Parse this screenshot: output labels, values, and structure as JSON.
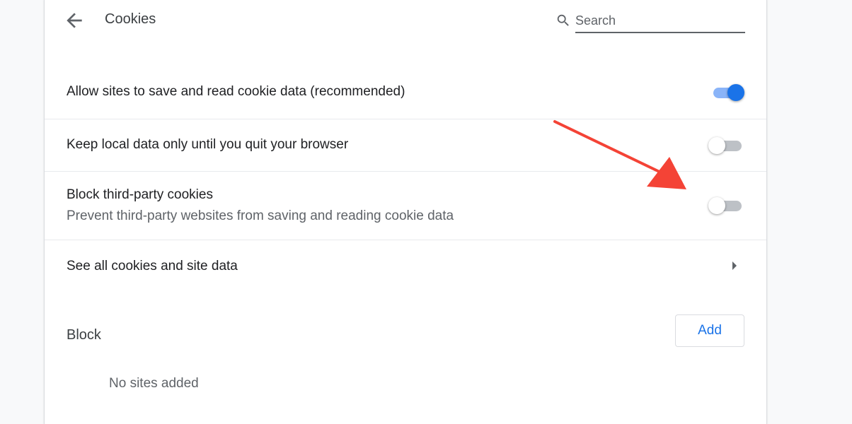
{
  "header": {
    "title": "Cookies",
    "back_icon": "arrow-back-icon",
    "search": {
      "placeholder": "Search",
      "value": "",
      "icon": "search-icon"
    }
  },
  "settings": [
    {
      "label": "Allow sites to save and read cookie data (recommended)",
      "enabled": true
    },
    {
      "label": "Keep local data only until you quit your browser",
      "enabled": false
    },
    {
      "label": "Block third-party cookies",
      "description": "Prevent third-party websites from saving and reading cookie data",
      "enabled": false
    }
  ],
  "see_all": {
    "label": "See all cookies and site data",
    "icon": "chevron-right-icon"
  },
  "block_section": {
    "title": "Block",
    "add_label": "Add",
    "empty_text": "No sites added"
  },
  "annotation": {
    "icon": "red-arrow-icon",
    "color": "#f44336"
  },
  "colors": {
    "accent": "#1a73e8",
    "toggle_on_track": "#8ab4f8",
    "toggle_off_track": "#bdc1c6"
  }
}
